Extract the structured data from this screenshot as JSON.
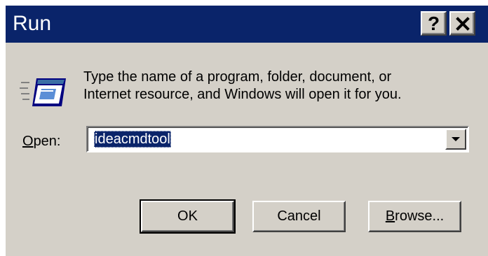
{
  "window": {
    "title": "Run"
  },
  "titlebar": {
    "help_label": "?",
    "close_icon": "close-icon"
  },
  "prompt": {
    "line1": "Type the name of a program, folder, document, or",
    "line2": "Internet resource, and Windows will open it for you."
  },
  "open_field": {
    "label_first": "O",
    "label_rest": "pen:",
    "value": "ideacmdtool"
  },
  "buttons": {
    "ok": "OK",
    "cancel": "Cancel",
    "browse_first": "B",
    "browse_rest": "rowse..."
  },
  "colors": {
    "titlebar": "#0a246a",
    "face": "#d4d0c8",
    "selection": "#0a246a"
  }
}
